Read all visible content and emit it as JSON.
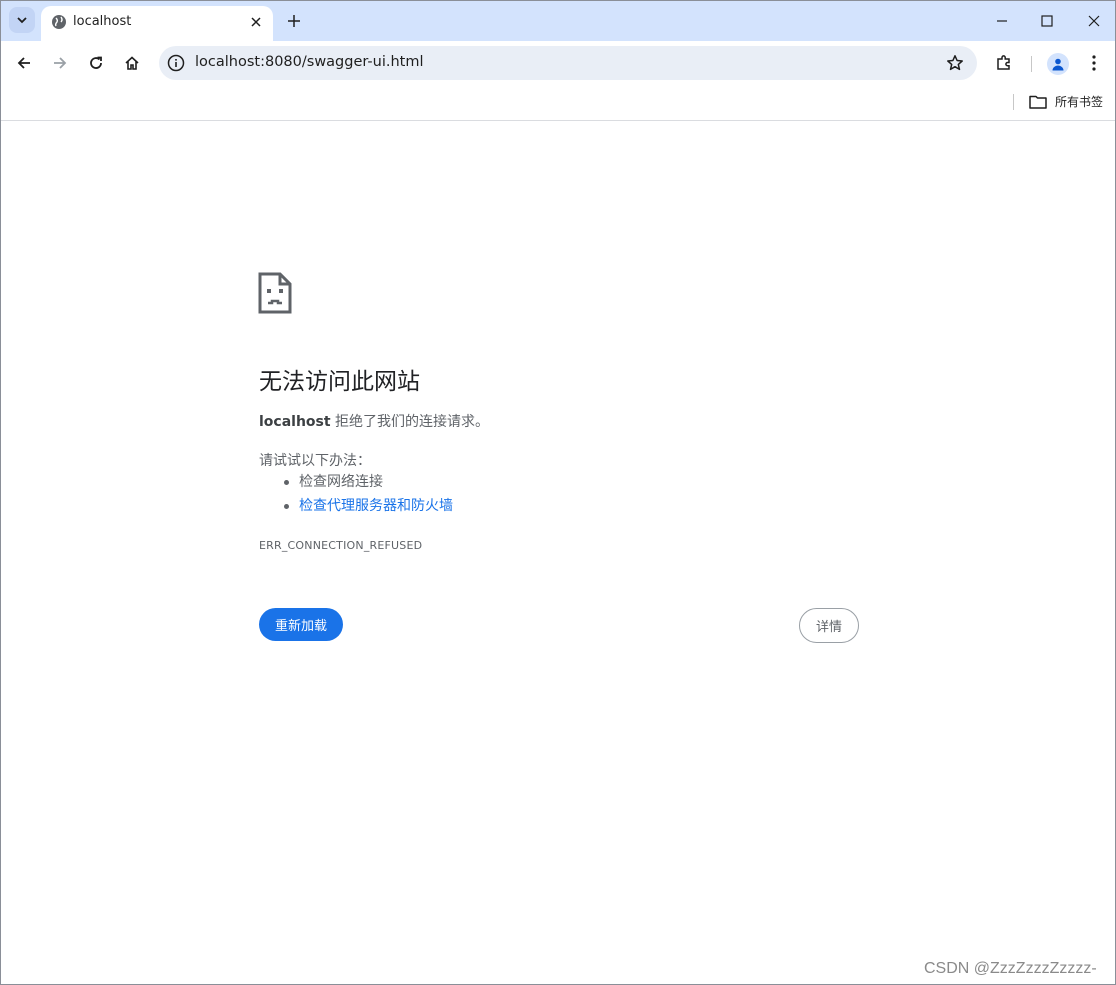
{
  "browser": {
    "tab": {
      "title": "localhost"
    },
    "address": {
      "url": "localhost:8080/swagger-ui.html"
    },
    "bookmarks": {
      "all_bookmarks_label": "所有书签"
    },
    "colors": {
      "tabstrip": "#d3e3fd",
      "omnibox": "#e9eef6",
      "accent": "#1a73e8"
    }
  },
  "error_page": {
    "title": "无法访问此网站",
    "host": "localhost",
    "description_suffix": " 拒绝了我们的连接请求。",
    "try_label": "请试试以下办法：",
    "suggestions": [
      {
        "label": "检查网络连接",
        "is_link": false
      },
      {
        "label": "检查代理服务器和防火墙",
        "is_link": true
      }
    ],
    "error_code": "ERR_CONNECTION_REFUSED",
    "reload_label": "重新加载",
    "details_label": "详情"
  },
  "watermark": "CSDN @ZzzZzzzZzzzz-"
}
